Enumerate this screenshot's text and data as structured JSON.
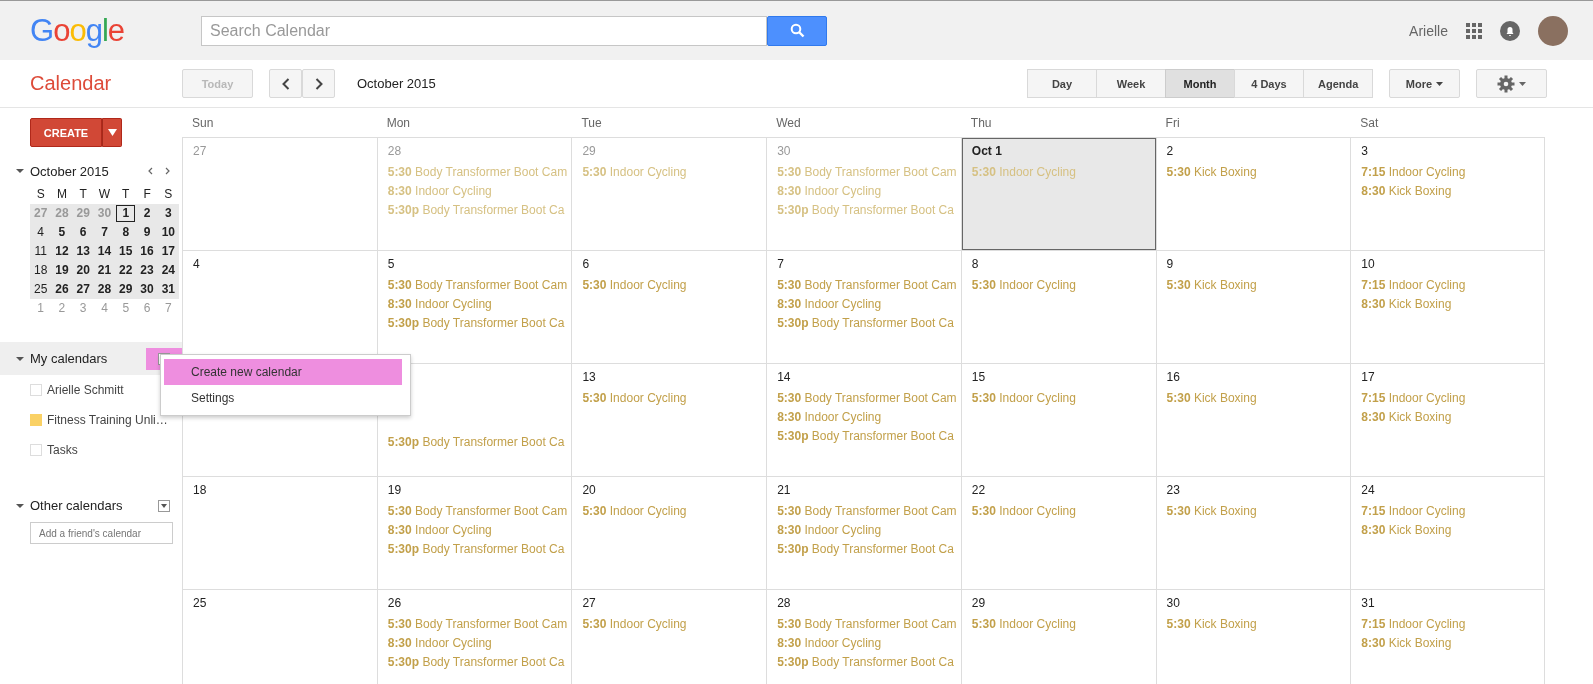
{
  "top_bar": {
    "logo": "Google",
    "search": {
      "placeholder": "Search Calendar"
    },
    "user_name": "Arielle"
  },
  "toolbar": {
    "app_title": "Calendar",
    "today_button": {
      "label": "Today",
      "disabled": true
    },
    "period": "October 2015",
    "views": [
      {
        "label": "Day",
        "selected": false
      },
      {
        "label": "Week",
        "selected": false
      },
      {
        "label": "Month",
        "selected": true
      },
      {
        "label": "4 Days",
        "selected": false
      },
      {
        "label": "Agenda",
        "selected": false
      }
    ],
    "more_button": "More"
  },
  "sidebar": {
    "create_button": "CREATE",
    "mini_calendar": {
      "title": "October 2015",
      "weekdays": [
        "S",
        "M",
        "T",
        "W",
        "T",
        "F",
        "S"
      ],
      "weeks": [
        {
          "shaded": true,
          "days": [
            {
              "label": "27",
              "muted": true,
              "bold": true,
              "today": false
            },
            {
              "label": "28",
              "muted": true,
              "bold": true,
              "today": false
            },
            {
              "label": "29",
              "muted": true,
              "bold": true,
              "today": false
            },
            {
              "label": "30",
              "muted": true,
              "bold": true,
              "today": false
            },
            {
              "label": "1",
              "muted": false,
              "bold": true,
              "today": true
            },
            {
              "label": "2",
              "muted": false,
              "bold": true,
              "today": false
            },
            {
              "label": "3",
              "muted": false,
              "bold": true,
              "today": false
            }
          ]
        },
        {
          "shaded": true,
          "days": [
            {
              "label": "4",
              "muted": false,
              "bold": false,
              "today": false
            },
            {
              "label": "5",
              "muted": false,
              "bold": true,
              "today": false
            },
            {
              "label": "6",
              "muted": false,
              "bold": true,
              "today": false
            },
            {
              "label": "7",
              "muted": false,
              "bold": true,
              "today": false
            },
            {
              "label": "8",
              "muted": false,
              "bold": true,
              "today": false
            },
            {
              "label": "9",
              "muted": false,
              "bold": true,
              "today": false
            },
            {
              "label": "10",
              "muted": false,
              "bold": true,
              "today": false
            }
          ]
        },
        {
          "shaded": true,
          "days": [
            {
              "label": "11",
              "muted": false,
              "bold": false,
              "today": false
            },
            {
              "label": "12",
              "muted": false,
              "bold": true,
              "today": false
            },
            {
              "label": "13",
              "muted": false,
              "bold": true,
              "today": false
            },
            {
              "label": "14",
              "muted": false,
              "bold": true,
              "today": false
            },
            {
              "label": "15",
              "muted": false,
              "bold": true,
              "today": false
            },
            {
              "label": "16",
              "muted": false,
              "bold": true,
              "today": false
            },
            {
              "label": "17",
              "muted": false,
              "bold": true,
              "today": false
            }
          ]
        },
        {
          "shaded": true,
          "days": [
            {
              "label": "18",
              "muted": false,
              "bold": false,
              "today": false
            },
            {
              "label": "19",
              "muted": false,
              "bold": true,
              "today": false
            },
            {
              "label": "20",
              "muted": false,
              "bold": true,
              "today": false
            },
            {
              "label": "21",
              "muted": false,
              "bold": true,
              "today": false
            },
            {
              "label": "22",
              "muted": false,
              "bold": true,
              "today": false
            },
            {
              "label": "23",
              "muted": false,
              "bold": true,
              "today": false
            },
            {
              "label": "24",
              "muted": false,
              "bold": true,
              "today": false
            }
          ]
        },
        {
          "shaded": true,
          "days": [
            {
              "label": "25",
              "muted": false,
              "bold": false,
              "today": false
            },
            {
              "label": "26",
              "muted": false,
              "bold": true,
              "today": false
            },
            {
              "label": "27",
              "muted": false,
              "bold": true,
              "today": false
            },
            {
              "label": "28",
              "muted": false,
              "bold": true,
              "today": false
            },
            {
              "label": "29",
              "muted": false,
              "bold": true,
              "today": false
            },
            {
              "label": "30",
              "muted": false,
              "bold": true,
              "today": false
            },
            {
              "label": "31",
              "muted": false,
              "bold": true,
              "today": false
            }
          ]
        },
        {
          "shaded": false,
          "days": [
            {
              "label": "1",
              "muted": true,
              "bold": false,
              "today": false
            },
            {
              "label": "2",
              "muted": true,
              "bold": false,
              "today": false
            },
            {
              "label": "3",
              "muted": true,
              "bold": false,
              "today": false
            },
            {
              "label": "4",
              "muted": true,
              "bold": false,
              "today": false
            },
            {
              "label": "5",
              "muted": true,
              "bold": false,
              "today": false
            },
            {
              "label": "6",
              "muted": true,
              "bold": false,
              "today": false
            },
            {
              "label": "7",
              "muted": true,
              "bold": false,
              "today": false
            }
          ]
        }
      ]
    },
    "my_calendars": {
      "title": "My calendars",
      "items": [
        {
          "label": "Arielle Schmitt",
          "checked": false
        },
        {
          "label": "Fitness Training Unli…",
          "checked": true,
          "color": "#fad165"
        },
        {
          "label": "Tasks",
          "checked": false
        }
      ]
    },
    "other_calendars": {
      "title": "Other calendars",
      "add_field": {
        "placeholder": "Add a friend's calendar"
      }
    },
    "menu": {
      "items": [
        {
          "label": "Create new calendar",
          "selected": true
        },
        {
          "label": "Settings",
          "selected": false
        }
      ]
    }
  },
  "month_grid": {
    "weekdays": [
      "Sun",
      "Mon",
      "Tue",
      "Wed",
      "Thu",
      "Fri",
      "Sat"
    ],
    "weeks": [
      [
        {
          "day": "27",
          "muted": true,
          "today": false
        },
        {
          "day": "28",
          "muted": true,
          "today": false,
          "events": [
            {
              "time": "5:30",
              "title": "Body Transformer Boot Cam",
              "past": true
            },
            {
              "time": "8:30",
              "title": "Indoor Cycling",
              "past": true
            },
            {
              "time": "5:30p",
              "title": "Body Transformer Boot Ca",
              "past": true
            }
          ]
        },
        {
          "day": "29",
          "muted": true,
          "today": false,
          "events": [
            {
              "time": "5:30",
              "title": "Indoor Cycling",
              "past": true
            }
          ]
        },
        {
          "day": "30",
          "muted": true,
          "today": false,
          "events": [
            {
              "time": "5:30",
              "title": "Body Transformer Boot Cam",
              "past": true
            },
            {
              "time": "8:30",
              "title": "Indoor Cycling",
              "past": true
            },
            {
              "time": "5:30p",
              "title": "Body Transformer Boot Ca",
              "past": true
            }
          ]
        },
        {
          "day": "Oct 1",
          "muted": false,
          "today": true,
          "events": [
            {
              "time": "5:30",
              "title": "Indoor Cycling",
              "past": true
            }
          ]
        },
        {
          "day": "2",
          "muted": false,
          "today": false,
          "events": [
            {
              "time": "5:30",
              "title": "Kick Boxing",
              "past": false
            }
          ]
        },
        {
          "day": "3",
          "muted": false,
          "today": false,
          "events": [
            {
              "time": "7:15",
              "title": "Indoor Cycling",
              "past": false
            },
            {
              "time": "8:30",
              "title": "Kick Boxing",
              "past": false
            }
          ]
        }
      ],
      [
        {
          "day": "4",
          "muted": false,
          "today": false
        },
        {
          "day": "5",
          "muted": false,
          "today": false,
          "events": [
            {
              "time": "5:30",
              "title": "Body Transformer Boot Cam",
              "past": false
            },
            {
              "time": "8:30",
              "title": "Indoor Cycling",
              "past": false
            },
            {
              "time": "5:30p",
              "title": "Body Transformer Boot Ca",
              "past": false
            }
          ]
        },
        {
          "day": "6",
          "muted": false,
          "today": false,
          "events": [
            {
              "time": "5:30",
              "title": "Indoor Cycling",
              "past": false
            }
          ]
        },
        {
          "day": "7",
          "muted": false,
          "today": false,
          "events": [
            {
              "time": "5:30",
              "title": "Body Transformer Boot Cam",
              "past": false
            },
            {
              "time": "8:30",
              "title": "Indoor Cycling",
              "past": false
            },
            {
              "time": "5:30p",
              "title": "Body Transformer Boot Ca",
              "past": false
            }
          ]
        },
        {
          "day": "8",
          "muted": false,
          "today": false,
          "events": [
            {
              "time": "5:30",
              "title": "Indoor Cycling",
              "past": false
            }
          ]
        },
        {
          "day": "9",
          "muted": false,
          "today": false,
          "events": [
            {
              "time": "5:30",
              "title": "Kick Boxing",
              "past": false
            }
          ]
        },
        {
          "day": "10",
          "muted": false,
          "today": false,
          "events": [
            {
              "time": "7:15",
              "title": "Indoor Cycling",
              "past": false
            },
            {
              "time": "8:30",
              "title": "Kick Boxing",
              "past": false
            }
          ]
        }
      ],
      [
        {
          "today": false
        },
        {
          "under_menu": true,
          "today": false,
          "events": [
            {
              "time": "5:30p",
              "title": "Body Transformer Boot Ca",
              "past": false
            }
          ]
        },
        {
          "day": "13",
          "muted": false,
          "today": false,
          "events": [
            {
              "time": "5:30",
              "title": "Indoor Cycling",
              "past": false
            }
          ]
        },
        {
          "day": "14",
          "muted": false,
          "today": false,
          "events": [
            {
              "time": "5:30",
              "title": "Body Transformer Boot Cam",
              "past": false
            },
            {
              "time": "8:30",
              "title": "Indoor Cycling",
              "past": false
            },
            {
              "time": "5:30p",
              "title": "Body Transformer Boot Ca",
              "past": false
            }
          ]
        },
        {
          "day": "15",
          "muted": false,
          "today": false,
          "events": [
            {
              "time": "5:30",
              "title": "Indoor Cycling",
              "past": false
            }
          ]
        },
        {
          "day": "16",
          "muted": false,
          "today": false,
          "events": [
            {
              "time": "5:30",
              "title": "Kick Boxing",
              "past": false
            }
          ]
        },
        {
          "day": "17",
          "muted": false,
          "today": false,
          "events": [
            {
              "time": "7:15",
              "title": "Indoor Cycling",
              "past": false
            },
            {
              "time": "8:30",
              "title": "Kick Boxing",
              "past": false
            }
          ]
        }
      ],
      [
        {
          "day": "18",
          "muted": false,
          "today": false
        },
        {
          "day": "19",
          "muted": false,
          "today": false,
          "events": [
            {
              "time": "5:30",
              "title": "Body Transformer Boot Cam",
              "past": false
            },
            {
              "time": "8:30",
              "title": "Indoor Cycling",
              "past": false
            },
            {
              "time": "5:30p",
              "title": "Body Transformer Boot Ca",
              "past": false
            }
          ]
        },
        {
          "day": "20",
          "muted": false,
          "today": false,
          "events": [
            {
              "time": "5:30",
              "title": "Indoor Cycling",
              "past": false
            }
          ]
        },
        {
          "day": "21",
          "muted": false,
          "today": false,
          "events": [
            {
              "time": "5:30",
              "title": "Body Transformer Boot Cam",
              "past": false
            },
            {
              "time": "8:30",
              "title": "Indoor Cycling",
              "past": false
            },
            {
              "time": "5:30p",
              "title": "Body Transformer Boot Ca",
              "past": false
            }
          ]
        },
        {
          "day": "22",
          "muted": false,
          "today": false,
          "events": [
            {
              "time": "5:30",
              "title": "Indoor Cycling",
              "past": false
            }
          ]
        },
        {
          "day": "23",
          "muted": false,
          "today": false,
          "events": [
            {
              "time": "5:30",
              "title": "Kick Boxing",
              "past": false
            }
          ]
        },
        {
          "day": "24",
          "muted": false,
          "today": false,
          "events": [
            {
              "time": "7:15",
              "title": "Indoor Cycling",
              "past": false
            },
            {
              "time": "8:30",
              "title": "Kick Boxing",
              "past": false
            }
          ]
        }
      ],
      [
        {
          "day": "25",
          "muted": false,
          "today": false
        },
        {
          "day": "26",
          "muted": false,
          "today": false,
          "events": [
            {
              "time": "5:30",
              "title": "Body Transformer Boot Cam",
              "past": false
            },
            {
              "time": "8:30",
              "title": "Indoor Cycling",
              "past": false
            },
            {
              "time": "5:30p",
              "title": "Body Transformer Boot Ca",
              "past": false
            }
          ]
        },
        {
          "day": "27",
          "muted": false,
          "today": false,
          "events": [
            {
              "time": "5:30",
              "title": "Indoor Cycling",
              "past": false
            }
          ]
        },
        {
          "day": "28",
          "muted": false,
          "today": false,
          "events": [
            {
              "time": "5:30",
              "title": "Body Transformer Boot Cam",
              "past": false
            },
            {
              "time": "8:30",
              "title": "Indoor Cycling",
              "past": false
            },
            {
              "time": "5:30p",
              "title": "Body Transformer Boot Ca",
              "past": false
            }
          ]
        },
        {
          "day": "29",
          "muted": false,
          "today": false,
          "events": [
            {
              "time": "5:30",
              "title": "Indoor Cycling",
              "past": false
            }
          ]
        },
        {
          "day": "30",
          "muted": false,
          "today": false,
          "events": [
            {
              "time": "5:30",
              "title": "Kick Boxing",
              "past": false
            }
          ]
        },
        {
          "day": "31",
          "muted": false,
          "today": false,
          "events": [
            {
              "time": "7:15",
              "title": "Indoor Cycling",
              "past": false
            },
            {
              "time": "8:30",
              "title": "Kick Boxing",
              "past": false
            }
          ]
        }
      ]
    ]
  }
}
